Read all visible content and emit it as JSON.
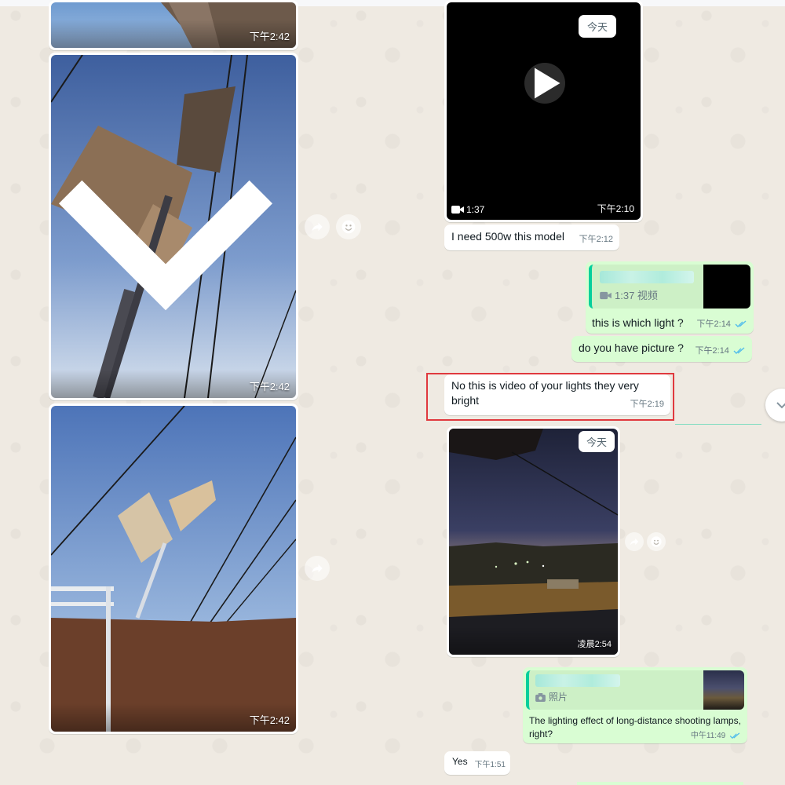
{
  "left_media": [
    {
      "time": "下午2:42"
    },
    {
      "time": "下午2:42"
    },
    {
      "time": "下午2:42"
    }
  ],
  "video_message": {
    "day_label": "今天",
    "duration": "1:37",
    "time": "下午2:10",
    "caption": "I need 500w this model",
    "caption_time": "下午2:12"
  },
  "reply_video": {
    "quoted_label": "1:37 视频",
    "text": "this is which light ?",
    "time": "下午2:14"
  },
  "picture_question": {
    "text": "do you have picture ?",
    "time": "下午2:14"
  },
  "highlighted_message": {
    "text": "No this is video of your lights they very bright",
    "time": "下午2:19"
  },
  "night_photo": {
    "day_label": "今天",
    "time": "凌晨2:54"
  },
  "reply_photo": {
    "quoted_label": "照片",
    "text": "The lighting effect of long-distance shooting lamps, right?",
    "time": "中午11:49"
  },
  "yes_message": {
    "text": "Yes",
    "time": "下午1:51"
  },
  "icons": [
    "chevron-down-icon",
    "play-icon",
    "video-camera-icon",
    "forward-icon",
    "emoji-icon",
    "double-check-icon",
    "camera-icon",
    "scroll-down-icon"
  ],
  "colors": {
    "chat_bg": "#efeae2",
    "outgoing": "#d9fdd3",
    "incoming": "#ffffff",
    "accent": "#06cf9c",
    "read_ticks": "#53bdeb",
    "highlight": "#e0393e"
  }
}
